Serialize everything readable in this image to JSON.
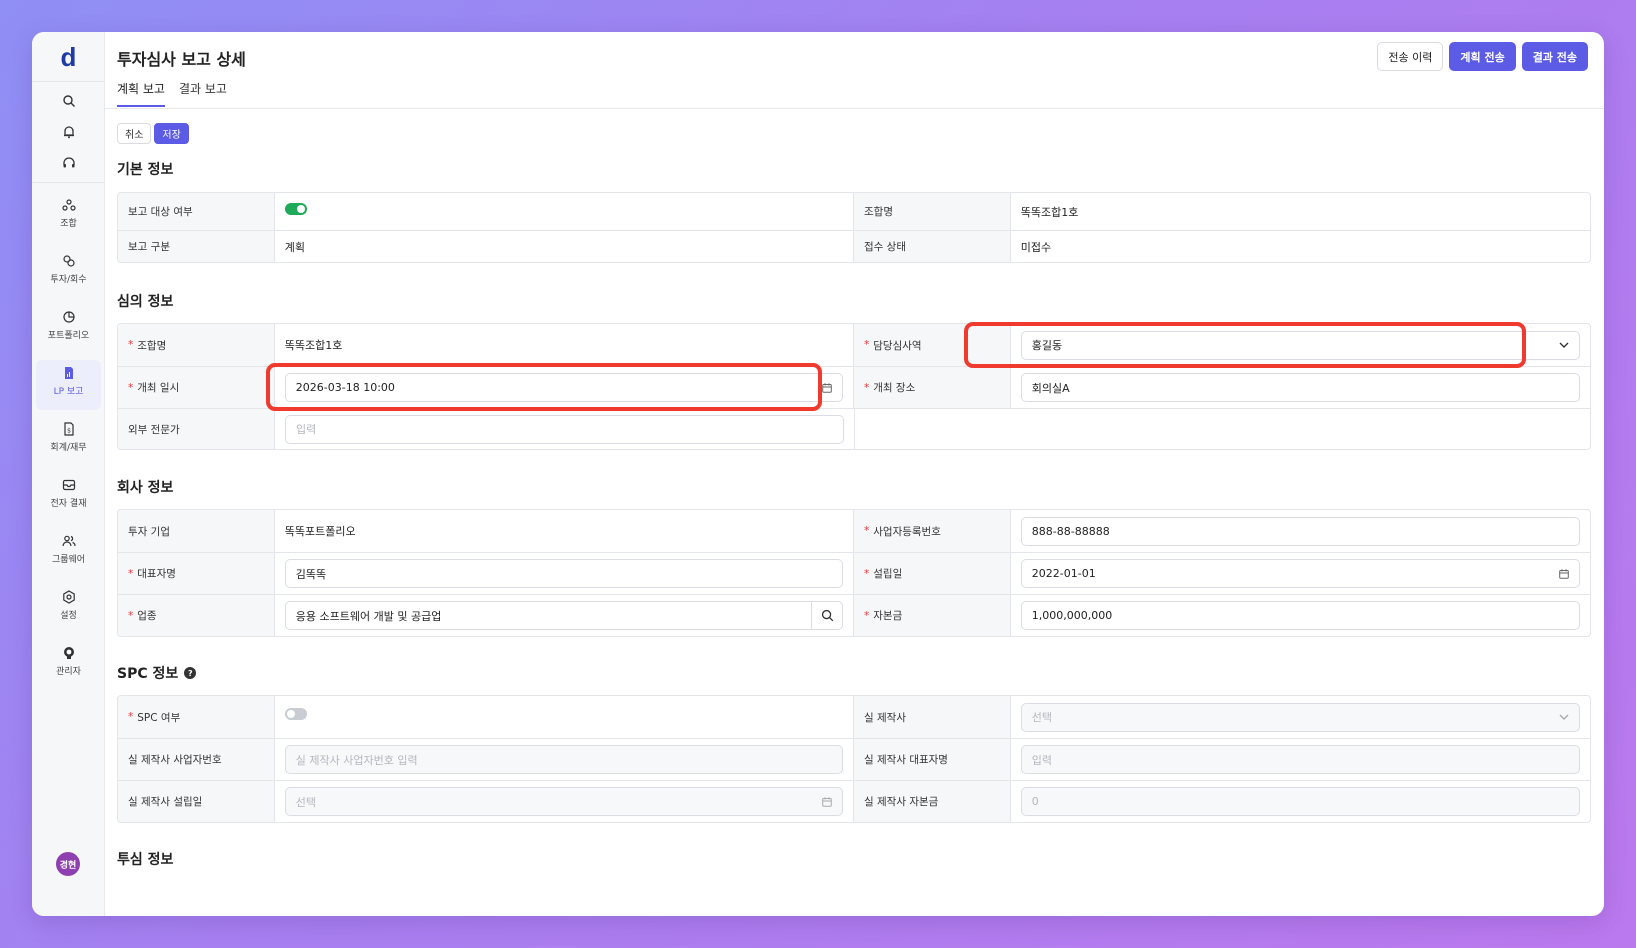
{
  "app": {
    "logo": "d",
    "page_title": "투자심사 보고 상세"
  },
  "tabs": [
    {
      "label": "계획 보고",
      "active": true
    },
    {
      "label": "결과 보고",
      "active": false
    }
  ],
  "top_buttons": {
    "history": "전송 이력",
    "send_plan": "계획 전송",
    "send_result": "결과 전송"
  },
  "edit_buttons": {
    "cancel": "취소",
    "save": "저장"
  },
  "sidebar": {
    "top_icons": [
      "search-icon",
      "bell-icon",
      "headset-icon"
    ],
    "items": [
      {
        "label": "조합",
        "icon": "union-icon",
        "active": false
      },
      {
        "label": "투자/회수",
        "icon": "invest-icon",
        "active": false
      },
      {
        "label": "포트폴리오",
        "icon": "pie-chart-icon",
        "active": false
      },
      {
        "label": "LP 보고",
        "icon": "report-icon",
        "active": true
      },
      {
        "label": "회계/재무",
        "icon": "ledger-icon",
        "active": false
      },
      {
        "label": "전자 결재",
        "icon": "approval-icon",
        "active": false
      },
      {
        "label": "그룹웨어",
        "icon": "users-icon",
        "active": false
      },
      {
        "label": "설정",
        "icon": "gear-icon",
        "active": false
      },
      {
        "label": "관리자",
        "icon": "admin-icon",
        "active": false
      }
    ],
    "avatar": "경현"
  },
  "basic_info": {
    "title": "기본 정보",
    "report_target_label": "보고 대상 여부",
    "report_target": true,
    "union_name_label": "조합명",
    "union_name": "똑똑조합1호",
    "report_type_label": "보고 구분",
    "report_type": "계획",
    "receipt_status_label": "접수 상태",
    "receipt_status": "미접수"
  },
  "review_info": {
    "title": "심의 정보",
    "union_name_label": "조합명",
    "union_name": "똑똑조합1호",
    "reviewer_label": "담당심사역",
    "reviewer": "홍길동",
    "datetime_label": "개최 일시",
    "datetime": "2026-03-18 10:00",
    "place_label": "개최 장소",
    "place": "회의실A",
    "expert_label": "외부 전문가",
    "expert_placeholder": "입력"
  },
  "company_info": {
    "title": "회사 정보",
    "company_label": "투자 기업",
    "company": "똑똑포트폴리오",
    "biz_no_label": "사업자등록번호",
    "biz_no": "888-88-88888",
    "ceo_label": "대표자명",
    "ceo": "김똑똑",
    "founded_label": "설립일",
    "founded": "2022-01-01",
    "industry_label": "업종",
    "industry": "응용 소프트웨어 개발 및 공급업",
    "capital_label": "자본금",
    "capital": "1,000,000,000"
  },
  "spc_info": {
    "title": "SPC 정보",
    "spc_label": "SPC 여부",
    "spc": false,
    "maker_label": "실 제작사",
    "maker_placeholder": "선택",
    "maker_biz_label": "실 제작사 사업자번호",
    "maker_biz_placeholder": "실 제작사 사업자번호 입력",
    "maker_ceo_label": "실 제작사 대표자명",
    "maker_ceo_placeholder": "입력",
    "maker_founded_label": "실 제작사 설립일",
    "maker_founded_placeholder": "선택",
    "maker_capital_label": "실 제작사 자본금",
    "maker_capital_placeholder": "0"
  },
  "invest_info": {
    "title": "투심 정보"
  },
  "colors": {
    "accent": "#5b5be6",
    "highlight": "#f03a2e",
    "toggle_on": "#1faa5a"
  }
}
